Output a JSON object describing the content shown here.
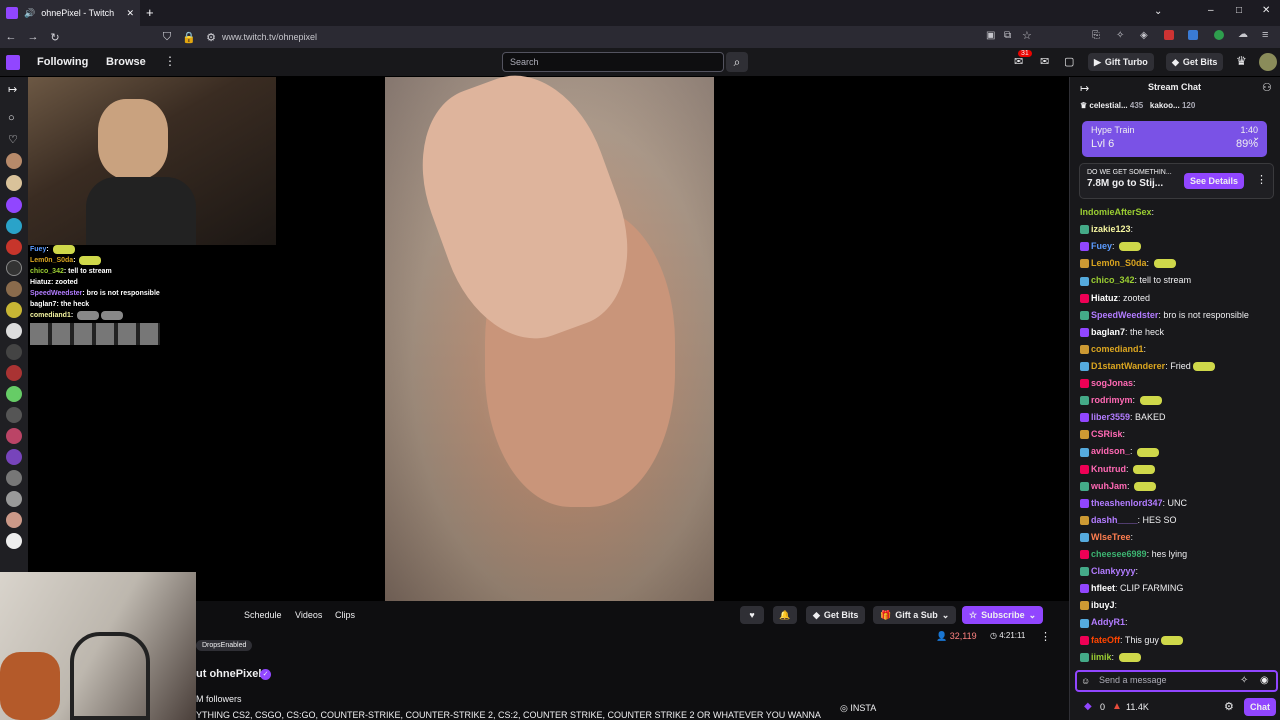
{
  "browser": {
    "tab_title": "ohnePixel - Twitch",
    "url": "www.twitch.tv/ohnepixel",
    "new_tab": "+",
    "close_tab": "✕"
  },
  "nav": {
    "following": "Following",
    "browse": "Browse",
    "search_placeholder": "Search",
    "notif_count": "31",
    "gift_turbo": "Gift Turbo",
    "get_bits": "Get Bits"
  },
  "webcam_overlay": [
    {
      "user": "Fuey",
      "text": ""
    },
    {
      "user": "Lem0n_S0da",
      "text": ""
    },
    {
      "user": "chico_342",
      "text": "tell  to stream"
    },
    {
      "user": "Hiatuz",
      "text": "zooted"
    },
    {
      "user": "SpeedWeedster",
      "text": "bro is not responsible"
    },
    {
      "user": "baglan7",
      "text": "the heck"
    },
    {
      "user": "comediand1",
      "text": ""
    }
  ],
  "channel": {
    "tabs": [
      "Schedule",
      "Videos",
      "Clips"
    ],
    "tag": "DropsEnabled",
    "about": "ut ohnePixel",
    "followers": "M followers",
    "description": "YTHING CS2, CSGO, CS:GO, COUNTER-STRIKE, COUNTER-STRIKE 2, CS:2, COUNTER STRIKE, COUNTER STRIKE 2 OR WHATEVER YOU WANNA",
    "viewers": "32,119",
    "uptime": "4:21:11",
    "insta": "INSTA",
    "get_bits": "Get Bits",
    "gift_sub": "Gift a Sub",
    "subscribe": "Subscribe"
  },
  "chat": {
    "title": "Stream Chat",
    "leaderboard": [
      {
        "name": "celestial...",
        "value": "435"
      },
      {
        "name": "kakoo...",
        "value": "120"
      }
    ],
    "hype": {
      "title": "Hype Train",
      "time": "1:40",
      "level": "Lvl 6",
      "percent": "89%"
    },
    "prediction": {
      "question": "DO WE GET SOMETHIN...",
      "text": "7.8M go to Stij...",
      "button": "See Details"
    },
    "messages": [
      {
        "user": "IndomieAfterSex",
        "color": "#9acd32",
        "text": ""
      },
      {
        "user": "izakie123",
        "color": "#f5f5a0",
        "text": ""
      },
      {
        "user": "Fuey",
        "color": "#5b9bff",
        "text": ""
      },
      {
        "user": "Lem0n_S0da",
        "color": "#daa520",
        "text": ""
      },
      {
        "user": "chico_342",
        "color": "#9acd32",
        "text": "tell  to stream"
      },
      {
        "user": "Hiatuz",
        "color": "#ffffff",
        "text": "zooted"
      },
      {
        "user": "SpeedWeedster",
        "color": "#b27cff",
        "text": "bro is not responsible"
      },
      {
        "user": "baglan7",
        "color": "#ffffff",
        "text": "the heck"
      },
      {
        "user": "comediand1",
        "color": "#daa520",
        "text": ""
      },
      {
        "user": "D1stantWanderer",
        "color": "#daa520",
        "text": "Fried"
      },
      {
        "user": "sogJonas",
        "color": "#ff69b4",
        "text": ""
      },
      {
        "user": "rodrimym",
        "color": "#ff69b4",
        "text": ""
      },
      {
        "user": "liber3559",
        "color": "#b27cff",
        "text": "BAKED"
      },
      {
        "user": "CSRisk",
        "color": "#ff69b4",
        "text": ""
      },
      {
        "user": "avidson_",
        "color": "#ff69b4",
        "text": ""
      },
      {
        "user": "Knutrud",
        "color": "#ff69b4",
        "text": ""
      },
      {
        "user": "wuhJam",
        "color": "#ff69b4",
        "text": ""
      },
      {
        "user": "theashenlord347",
        "color": "#b27cff",
        "text": "UNC"
      },
      {
        "user": "dashh____",
        "color": "#b27cff",
        "text": "HES SO"
      },
      {
        "user": "WlseTree",
        "color": "#ff7f50",
        "text": ""
      },
      {
        "user": "cheesee6989",
        "color": "#3cb371",
        "text": "hes lying"
      },
      {
        "user": "Clankyyyy",
        "color": "#b27cff",
        "text": ""
      },
      {
        "user": "hfleet",
        "color": "#ffffff",
        "text": "CLIP FARMING"
      },
      {
        "user": "ibuyJ",
        "color": "#ffffff",
        "text": ""
      },
      {
        "user": "AddyR1",
        "color": "#b27cff",
        "text": ""
      },
      {
        "user": "fateOff",
        "color": "#ff4500",
        "text": "This guy"
      },
      {
        "user": "iimik",
        "color": "#9acd32",
        "text": ""
      }
    ],
    "input_placeholder": "Send a message",
    "points": "0",
    "bits": "11.4K",
    "chat_button": "Chat"
  },
  "colors": {
    "accent": "#9146ff",
    "hype": "#7a52e6",
    "bg": "#0e0e10",
    "live_red": "#eb0400"
  }
}
